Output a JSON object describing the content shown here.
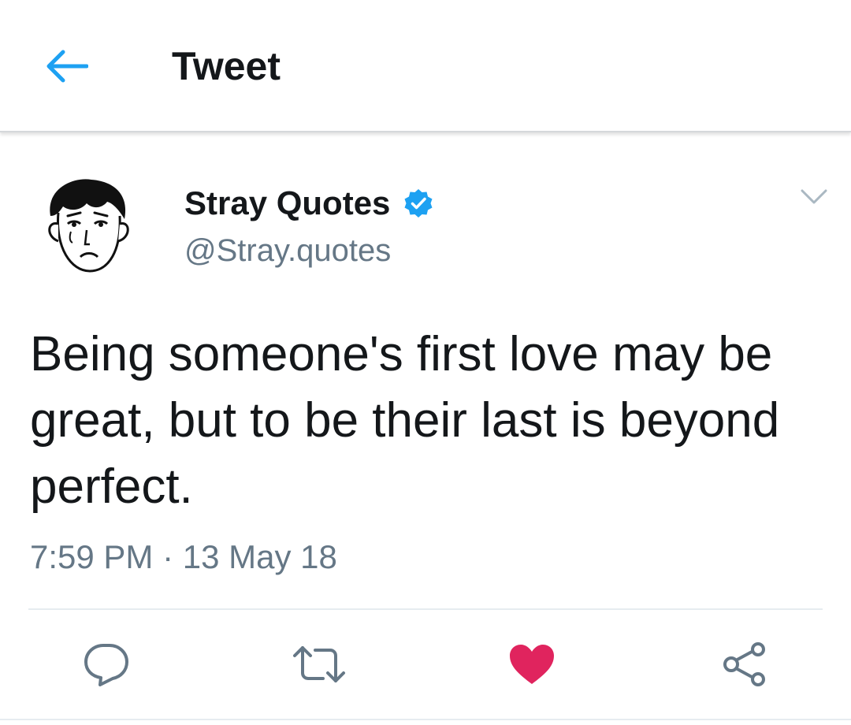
{
  "header": {
    "title": "Tweet",
    "back_icon": "arrow-left-icon"
  },
  "tweet": {
    "author": {
      "display_name": "Stray Quotes",
      "handle": "@Stray.quotes",
      "verified": true,
      "verified_icon": "verified-badge-icon",
      "avatar": "cartoon-face-avatar"
    },
    "text": "Being someone's first love may be great, but to be their last is beyond perfect.",
    "timestamp": "7:59 PM · 13 May 18",
    "menu_icon": "chevron-down-icon"
  },
  "actions": {
    "reply_icon": "reply-icon",
    "retweet_icon": "retweet-icon",
    "like_icon": "heart-icon",
    "like_active": true,
    "share_icon": "share-icon"
  },
  "colors": {
    "accent": "#1da1f2",
    "like": "#e0245e",
    "secondary_text": "#657786",
    "icon_gray": "#657786"
  }
}
